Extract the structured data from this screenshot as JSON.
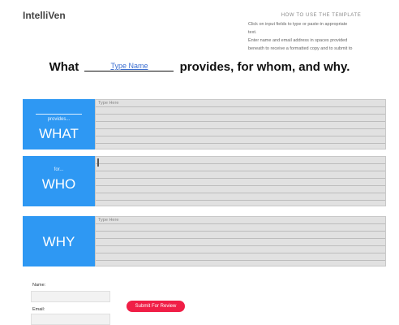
{
  "brand": {
    "name": "IntelliVen"
  },
  "instructions": {
    "title": "HOW TO USE THE TEMPLATE",
    "lines": [
      "Click on input fields to type or paste-in appropriate",
      "text.",
      "Enter name and email address in spaces provided",
      "beneath to receive a formatted copy and to submit to"
    ]
  },
  "headline": {
    "prefix": "What",
    "name_placeholder": "Type Name",
    "suffix": "provides, for whom, and why."
  },
  "sections": [
    {
      "small_label": "provides...",
      "big_label": "WHAT",
      "placeholder": "Type Here"
    },
    {
      "small_label": "for...",
      "big_label": "WHO",
      "placeholder": ""
    },
    {
      "small_label": "",
      "big_label": "WHY",
      "placeholder": "Type Here"
    }
  ],
  "form": {
    "name_label": "Name:",
    "email_label": "Email:",
    "submit_label": "Submit For Review"
  },
  "colors": {
    "accent_blue": "#2e98f3",
    "submit_red": "#f01e46",
    "field_gray": "#e1e1e1"
  }
}
